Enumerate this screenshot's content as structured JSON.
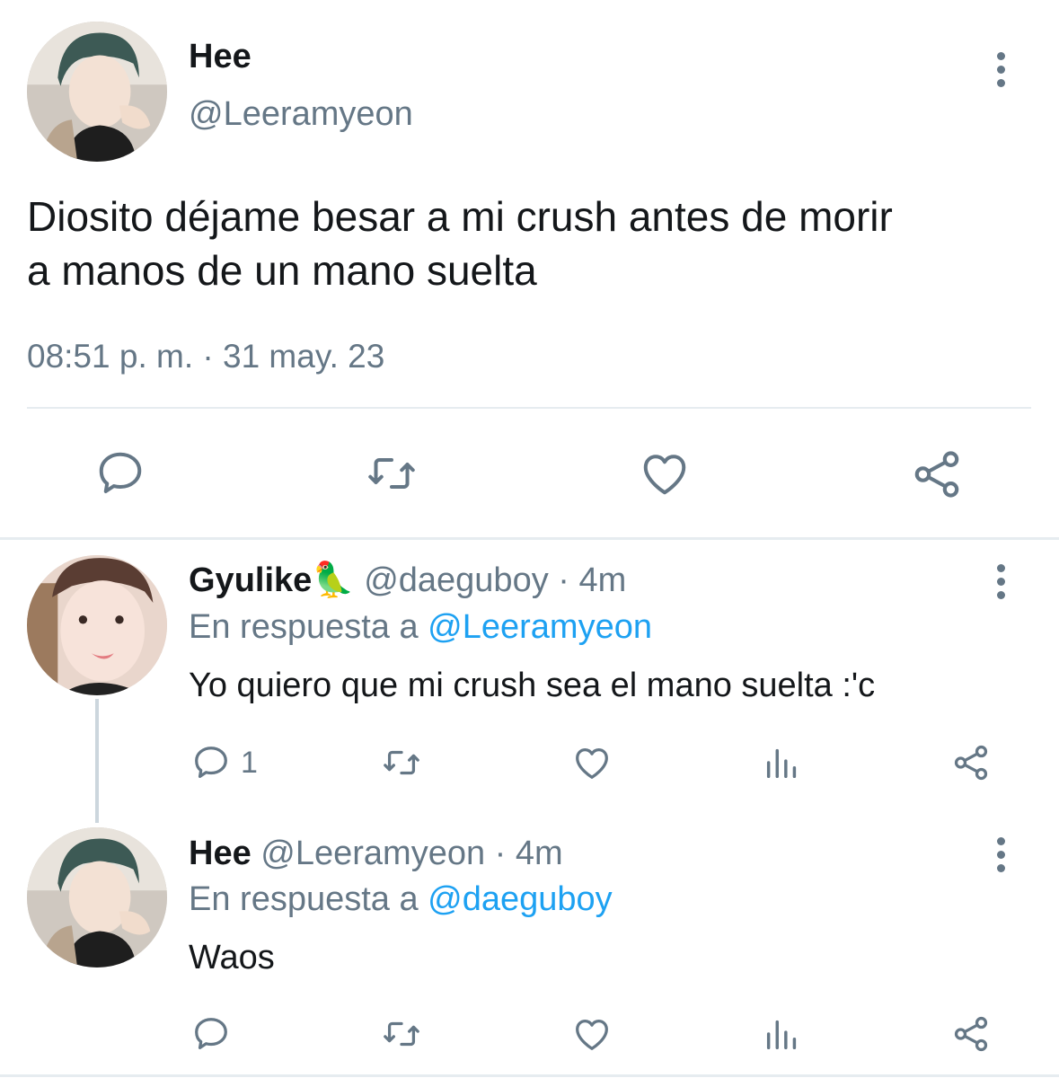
{
  "tweet": {
    "name": "Hee",
    "handle": "@Leeramyeon",
    "text_line1": "Diosito déjame besar a mi crush antes de morir",
    "text_line2": "a manos de un mano suelta",
    "timestamp": "08:51 p. m. · 31 may. 23",
    "actions": [
      "reply-icon",
      "retweet-icon",
      "like-icon",
      "share-icon"
    ]
  },
  "replies": [
    {
      "name": "Gyulike",
      "emoji": "🦜",
      "handle": "@daeguboy",
      "time": "· 4m",
      "in_reply_prefix": "En respuesta a",
      "in_reply_to": "@Leeramyeon",
      "text": "Yo quiero que mi crush sea el mano suelta :'c",
      "reply_count": "1"
    },
    {
      "name": "Hee",
      "handle": "@Leeramyeon",
      "time": "· 4m",
      "in_reply_prefix": "En respuesta a",
      "in_reply_to": "@daeguboy",
      "text": "Waos",
      "reply_count": ""
    }
  ],
  "colors": {
    "text": "#14171a",
    "secondary": "#657786",
    "link": "#1da1f2",
    "divider": "#e6ecf0"
  }
}
